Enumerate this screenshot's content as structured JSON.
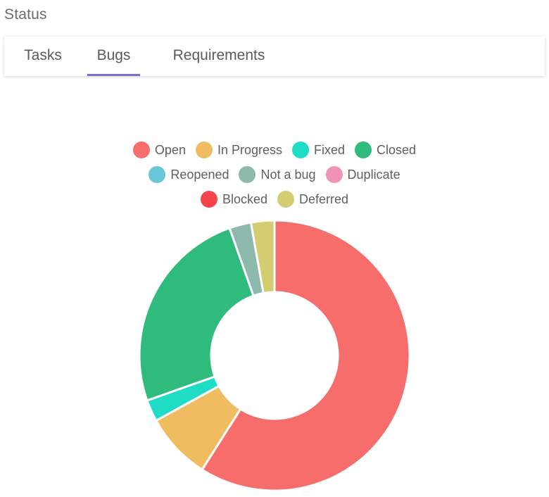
{
  "section": {
    "title": "Status"
  },
  "tabs": [
    {
      "label": "Tasks",
      "active": false
    },
    {
      "label": "Bugs",
      "active": true
    },
    {
      "label": "Requirements",
      "active": false
    }
  ],
  "colors": {
    "tab_active": "#7b6fd6"
  },
  "chart_data": {
    "type": "pie",
    "variant": "doughnut",
    "title": "",
    "legend_position": "top",
    "categories": [
      "Open",
      "In Progress",
      "Fixed",
      "Closed",
      "Reopened",
      "Not a bug",
      "Duplicate",
      "Blocked",
      "Deferred"
    ],
    "values": [
      59,
      8,
      2.6,
      25,
      0,
      2.6,
      0,
      0,
      2.8
    ],
    "colors": [
      "#f66d6b",
      "#efbc60",
      "#1fdcc4",
      "#2fbb7b",
      "#66c6d6",
      "#8db9ac",
      "#ee93b5",
      "#f7434a",
      "#d4cc70"
    ],
    "legend_rows": [
      [
        0,
        1,
        2,
        3
      ],
      [
        4,
        5,
        6
      ],
      [
        7,
        8
      ]
    ]
  }
}
